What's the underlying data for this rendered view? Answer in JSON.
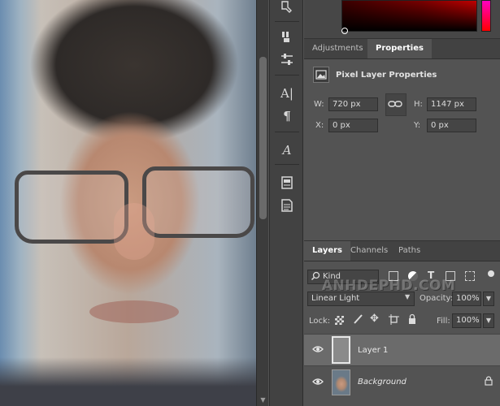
{
  "properties_tabs": [
    {
      "label": "Adjustments",
      "active": false
    },
    {
      "label": "Properties",
      "active": true
    }
  ],
  "properties": {
    "title": "Pixel Layer Properties",
    "w_label": "W:",
    "w_value": "720 px",
    "h_label": "H:",
    "h_value": "1147 px",
    "x_label": "X:",
    "x_value": "0 px",
    "y_label": "Y:",
    "y_value": "0 px"
  },
  "layers_tabs": [
    {
      "label": "Layers",
      "active": true
    },
    {
      "label": "Channels",
      "active": false
    },
    {
      "label": "Paths",
      "active": false
    }
  ],
  "filter": {
    "kind_label": "Kind"
  },
  "blend": {
    "mode": "Linear Light",
    "opacity_label": "Opacity:",
    "opacity_value": "100%"
  },
  "lock": {
    "label": "Lock:",
    "fill_label": "Fill:",
    "fill_value": "100%"
  },
  "watermark": "ANHDEPHD.COM",
  "layers": [
    {
      "name": "Layer 1",
      "selected": true,
      "italic": false
    },
    {
      "name": "Background",
      "selected": false,
      "italic": true
    }
  ],
  "colors": {
    "panel": "#535353",
    "tabbar": "#424242",
    "selected_row": "#6b6b6b"
  }
}
